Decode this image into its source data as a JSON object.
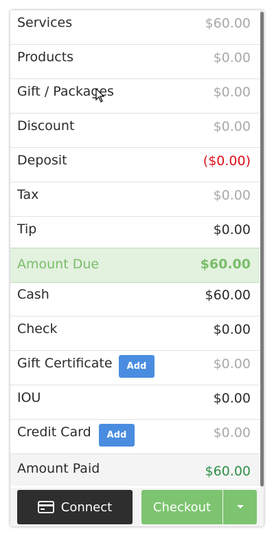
{
  "summary_rows": [
    {
      "label": "Services",
      "value": "$60.00"
    },
    {
      "label": "Products",
      "value": "$0.00"
    },
    {
      "label": "Gift / Packages",
      "value": "$0.00"
    },
    {
      "label": "Discount",
      "value": "$0.00"
    },
    {
      "label": "Deposit",
      "value": "($0.00)"
    },
    {
      "label": "Tax",
      "value": "$0.00"
    },
    {
      "label": "Tip",
      "value": "$0.00"
    }
  ],
  "amount_due": {
    "label": "Amount Due",
    "value": "$60.00"
  },
  "payment_rows": [
    {
      "label": "Cash",
      "value": "$60.00"
    },
    {
      "label": "Check",
      "value": "$0.00"
    },
    {
      "label": "Gift Certificate",
      "value": "$0.00",
      "action": "Add"
    },
    {
      "label": "IOU",
      "value": "$0.00"
    },
    {
      "label": "Credit Card",
      "value": "$0.00",
      "action": "Add"
    }
  ],
  "amount_paid": {
    "label": "Amount Paid",
    "value": "$60.00"
  },
  "footer": {
    "connect_label": "Connect",
    "checkout_label": "Checkout"
  },
  "colors": {
    "accent_green": "#7cc470",
    "due_green": "#79bd69",
    "paid_green": "#2f8f48",
    "deposit_red": "#e0101a",
    "add_blue": "#4a8de0",
    "connect_dark": "#2e2e2e"
  },
  "icons": {
    "connect": "credit-card-icon",
    "checkout_menu": "caret-down-icon"
  }
}
